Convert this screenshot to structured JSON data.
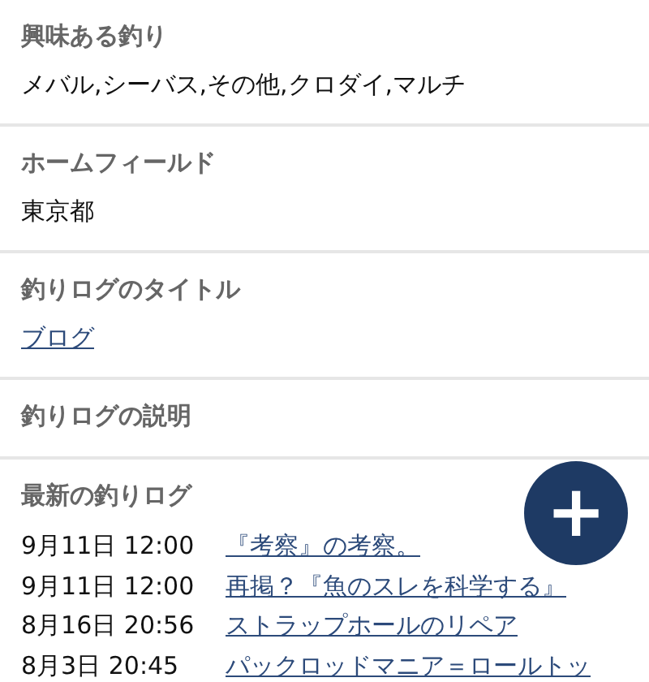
{
  "sections": [
    {
      "label": "興味ある釣り",
      "value": "メバル,シーバス,その他,クロダイ,マルチ",
      "kind": "text"
    },
    {
      "label": "ホームフィールド",
      "value": "東京都",
      "kind": "text"
    },
    {
      "label": "釣りログのタイトル",
      "value": "ブログ",
      "kind": "link"
    },
    {
      "label": "釣りログの説明",
      "kind": "empty"
    }
  ],
  "latest_logs": {
    "label": "最新の釣りログ",
    "rows": [
      {
        "date": "9月11日 12:00",
        "title": "『考察』の考察。"
      },
      {
        "date": "9月11日 12:00",
        "title": "再掲？『魚のスレを科学する』"
      },
      {
        "date": "8月16日 20:56",
        "title": "ストラップホールのリペア"
      },
      {
        "date": "8月3日 20:45",
        "title": "パックロッドマニア＝ロールトッ"
      }
    ]
  },
  "fab": {
    "label": "+"
  }
}
